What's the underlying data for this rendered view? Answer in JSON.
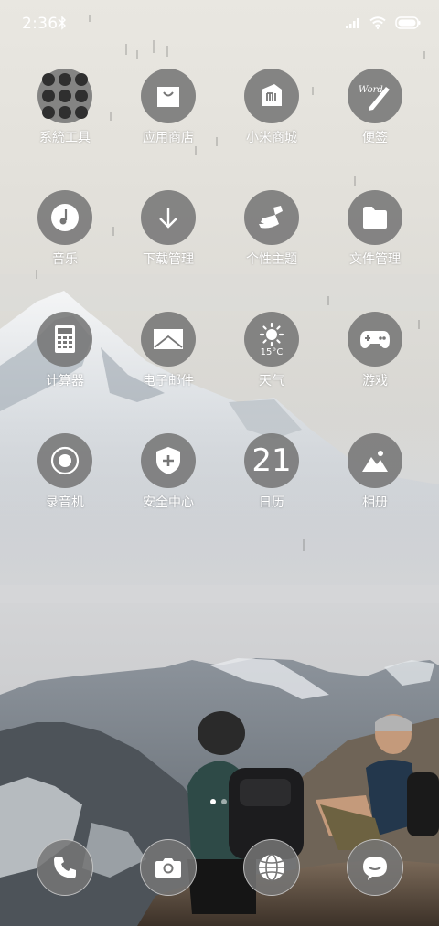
{
  "status_bar": {
    "time": "2:36",
    "icons": [
      "bluetooth-icon",
      "signal-icon",
      "wifi-icon",
      "battery-icon"
    ]
  },
  "apps": [
    {
      "label": "系統工具",
      "icon": "folder-icon"
    },
    {
      "label": "应用商店",
      "icon": "shopping-bag-icon"
    },
    {
      "label": "小米商城",
      "icon": "mi-store-icon"
    },
    {
      "label": "便签",
      "icon": "notes-pen-icon"
    },
    {
      "label": "音乐",
      "icon": "music-icon"
    },
    {
      "label": "下载管理",
      "icon": "download-icon"
    },
    {
      "label": "个性主题",
      "icon": "theme-brush-icon"
    },
    {
      "label": "文件管理",
      "icon": "file-folder-icon"
    },
    {
      "label": "计算器",
      "icon": "calculator-icon"
    },
    {
      "label": "电子邮件",
      "icon": "email-icon"
    },
    {
      "label": "天气",
      "icon": "weather-sun-icon",
      "temperature": "15°C"
    },
    {
      "label": "游戏",
      "icon": "gamepad-icon"
    },
    {
      "label": "录音机",
      "icon": "recorder-icon"
    },
    {
      "label": "安全中心",
      "icon": "security-shield-icon"
    },
    {
      "label": "日历",
      "icon": "calendar-icon",
      "date": "21"
    },
    {
      "label": "相册",
      "icon": "gallery-icon"
    }
  ],
  "notes_icon_text": "Word",
  "page_indicator": {
    "pages": 2,
    "current": 1
  },
  "dock": [
    "phone-icon",
    "camera-icon",
    "browser-icon",
    "messages-icon"
  ]
}
